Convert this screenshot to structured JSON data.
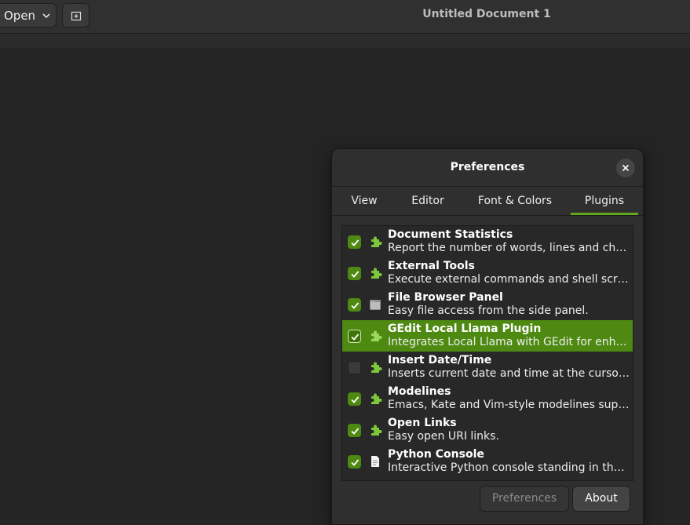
{
  "headerbar": {
    "open_label": "Open",
    "title": "Untitled Document 1"
  },
  "dialog": {
    "title": "Preferences",
    "tabs": [
      {
        "label": "View"
      },
      {
        "label": "Editor"
      },
      {
        "label": "Font & Colors"
      },
      {
        "label": "Plugins",
        "active": true
      }
    ],
    "plugins": [
      {
        "name": "Document Statistics",
        "description": "Report the number of words, lines and characters in a document.",
        "enabled": true,
        "icon": "puzzle-piece-icon"
      },
      {
        "name": "External Tools",
        "description": "Execute external commands and shell scripts.",
        "enabled": true,
        "icon": "puzzle-piece-icon"
      },
      {
        "name": "File Browser Panel",
        "description": "Easy file access from the side panel.",
        "enabled": true,
        "icon": "folder-icon"
      },
      {
        "name": "GEdit Local Llama Plugin",
        "description": "Integrates Local Llama with GEdit for enhanced text generation.",
        "enabled": true,
        "selected": true,
        "icon": "puzzle-piece-icon"
      },
      {
        "name": "Insert Date/Time",
        "description": "Inserts current date and time at the cursor position.",
        "enabled": false,
        "icon": "puzzle-piece-icon"
      },
      {
        "name": "Modelines",
        "description": "Emacs, Kate and Vim-style modelines support for gedit.",
        "enabled": true,
        "icon": "puzzle-piece-icon"
      },
      {
        "name": "Open Links",
        "description": "Easy open URI links.",
        "enabled": true,
        "icon": "puzzle-piece-icon"
      },
      {
        "name": "Python Console",
        "description": "Interactive Python console standing in the bottom panel.",
        "enabled": true,
        "icon": "text-document-icon"
      }
    ],
    "buttons": {
      "preferences_label": "Preferences",
      "about_label": "About"
    }
  },
  "colors": {
    "accent": "#4e8a12",
    "tab_underline": "#62a61f",
    "window_bg": "#242424",
    "dialog_bg": "#2f2f2f"
  }
}
